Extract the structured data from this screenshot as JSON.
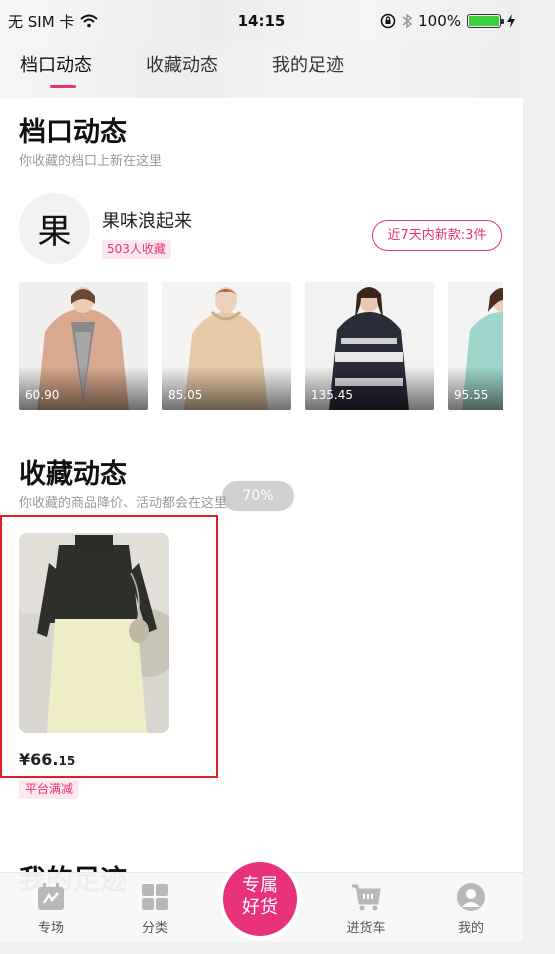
{
  "status_bar": {
    "carrier": "无 SIM 卡",
    "time": "14:15",
    "battery": "100%",
    "battery_level": 1.0
  },
  "top_tabs": [
    {
      "label": "档口动态",
      "active": true
    },
    {
      "label": "收藏动态",
      "active": false
    },
    {
      "label": "我的足迹",
      "active": false
    }
  ],
  "shop_section": {
    "title": "档口动态",
    "subtitle": "你收藏的档口上新在这里",
    "shop": {
      "avatar_char": "果",
      "name": "果味浪起来",
      "fav_count": "503人收藏",
      "new_items_button": "近7天内新款:3件"
    },
    "products": [
      {
        "price": "60.90"
      },
      {
        "price": "85.05"
      },
      {
        "price": "135.45"
      },
      {
        "price": "95.55"
      }
    ]
  },
  "fav_section": {
    "title": "收藏动态",
    "subtitle": "你收藏的商品降价、活动都会在这里",
    "toast": "70%",
    "item": {
      "price_main": "¥66.",
      "price_decimal": "15",
      "promo": "平台满减"
    }
  },
  "footprint_section": {
    "title": "我的足迹"
  },
  "bottom_nav": {
    "items": [
      {
        "label": "专场",
        "icon": "calendar-icon"
      },
      {
        "label": "分类",
        "icon": "grid-icon"
      },
      {
        "label": "进货车",
        "icon": "cart-icon"
      },
      {
        "label": "我的",
        "icon": "user-icon"
      }
    ],
    "center_button": {
      "line1": "专属",
      "line2": "好货"
    }
  },
  "colors": {
    "accent": "#e8336d",
    "center_button": "#e8337c",
    "highlight_border": "#e02020"
  }
}
